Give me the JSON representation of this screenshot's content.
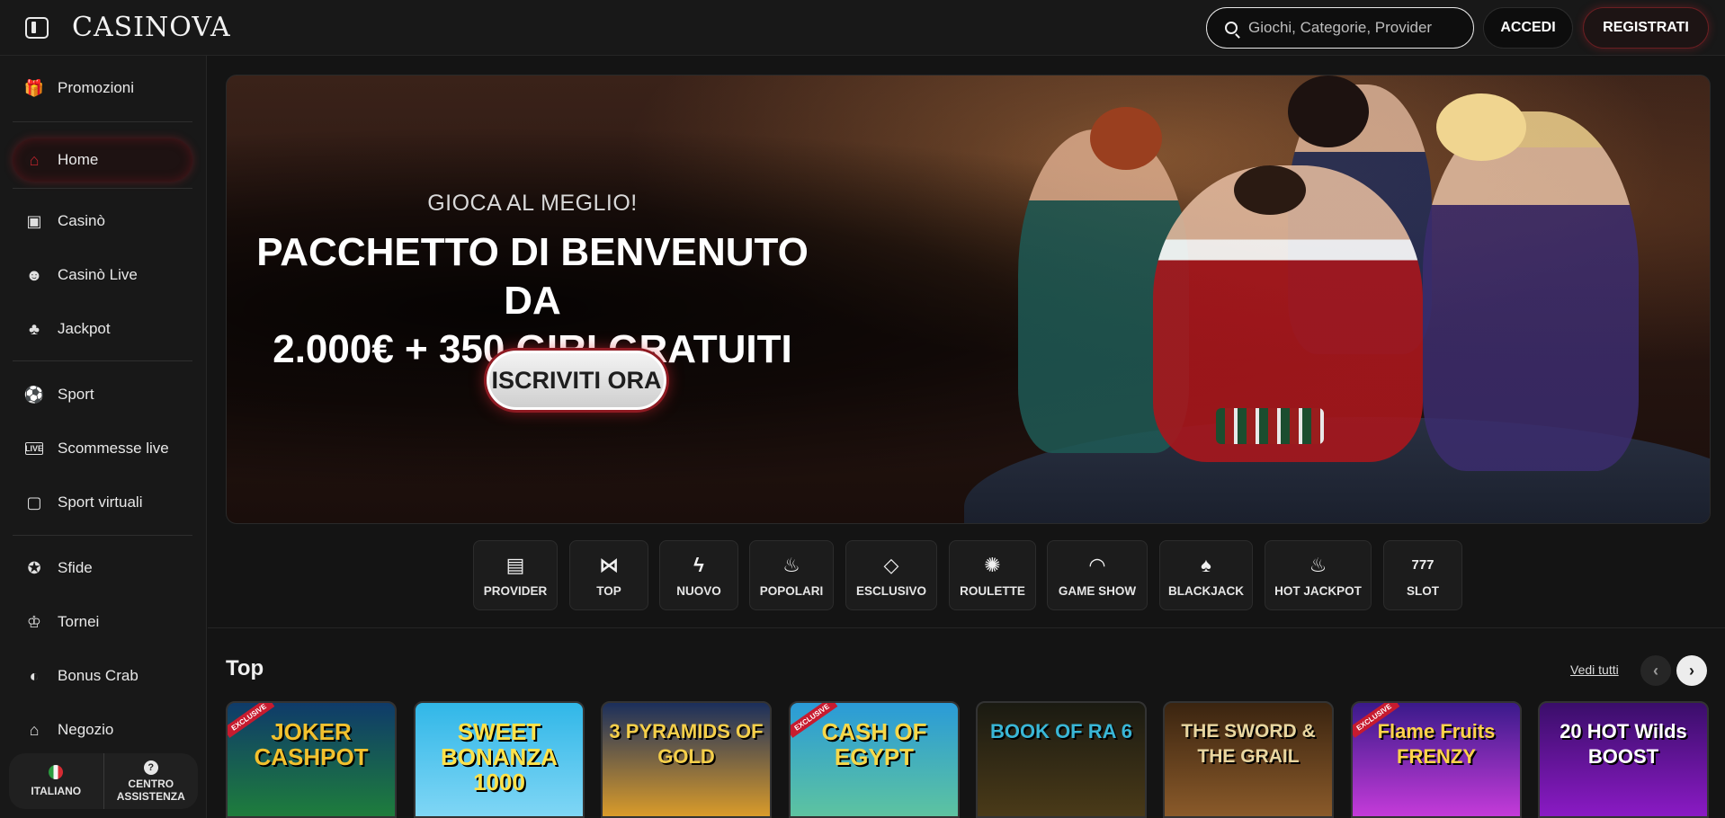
{
  "header": {
    "logo": "CASINOVA",
    "search_placeholder": "Giochi, Categorie, Provider",
    "login_label": "ACCEDI",
    "register_label": "REGISTRATI"
  },
  "sidebar": {
    "items": [
      {
        "label": "Promozioni",
        "icon": "gift-icon"
      },
      {
        "label": "Home",
        "icon": "home-icon"
      },
      {
        "label": "Casinò",
        "icon": "slot-machine-icon"
      },
      {
        "label": "Casinò Live",
        "icon": "live-dealer-icon"
      },
      {
        "label": "Jackpot",
        "icon": "clover-icon"
      },
      {
        "label": "Sport",
        "icon": "soccer-ball-icon"
      },
      {
        "label": "Scommesse live",
        "icon": "live-badge-icon"
      },
      {
        "label": "Sport virtuali",
        "icon": "virtual-sport-icon"
      },
      {
        "label": "Sfide",
        "icon": "medal-icon"
      },
      {
        "label": "Tornei",
        "icon": "trophy-icon"
      },
      {
        "label": "Bonus Crab",
        "icon": "crab-icon"
      },
      {
        "label": "Negozio",
        "icon": "shop-icon"
      }
    ],
    "language_label": "ITALIANO",
    "help_label": "CENTRO ASSISTENZA",
    "active_color": "#c0242c"
  },
  "banner": {
    "eyebrow": "GIOCA AL MEGLIO!",
    "headline_line1": "PACCHETTO DI BENVENUTO DA",
    "headline_line2": "2.000€ + 350 GIRI GRATUITI",
    "cta_label": "ISCRIVITI ORA"
  },
  "categories": [
    {
      "label": "PROVIDER",
      "icon": "provider-card-icon"
    },
    {
      "label": "TOP",
      "icon": "bowtie-icon"
    },
    {
      "label": "NUOVO",
      "icon": "lightning-icon"
    },
    {
      "label": "POPOLARI",
      "icon": "flame-icon"
    },
    {
      "label": "ESCLUSIVO",
      "icon": "diamond-icon"
    },
    {
      "label": "ROULETTE",
      "icon": "roulette-icon"
    },
    {
      "label": "GAME SHOW",
      "icon": "mask-icon"
    },
    {
      "label": "BLACKJACK",
      "icon": "cards-icon"
    },
    {
      "label": "HOT JACKPOT",
      "icon": "hot-jackpot-icon"
    },
    {
      "label": "SLOT",
      "icon": "777-icon"
    }
  ],
  "top_section": {
    "title": "Top",
    "see_all_label": "Vedi tutti",
    "games": [
      {
        "name": "JOKER CASHPOT",
        "exclusive": true
      },
      {
        "name": "SWEET BONANZA 1000",
        "exclusive": false
      },
      {
        "name": "3 PYRAMIDS OF GOLD",
        "exclusive": false
      },
      {
        "name": "CASH OF EGYPT",
        "exclusive": true
      },
      {
        "name": "BOOK OF RA 6",
        "exclusive": false
      },
      {
        "name": "THE SWORD & THE GRAIL",
        "exclusive": false
      },
      {
        "name": "Flame Fruits FRENZY",
        "exclusive": true
      },
      {
        "name": "20 HOT Wilds BOOST",
        "exclusive": false
      }
    ],
    "exclusive_badge": "EXCLUSIVE"
  }
}
